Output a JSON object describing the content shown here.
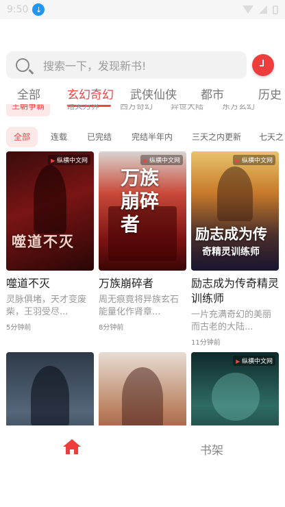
{
  "status_bar": {
    "time": "9:50"
  },
  "search": {
    "placeholder": "搜索一下，发现新书!"
  },
  "tabs": [
    {
      "label": "全部"
    },
    {
      "label": "玄幻奇幻"
    },
    {
      "label": "武侠仙侠"
    },
    {
      "label": "都市"
    },
    {
      "label": "历史"
    }
  ],
  "subcategories": [
    {
      "label": "王朝争霸"
    },
    {
      "label": "诸天万界"
    },
    {
      "label": "西方奇幻"
    },
    {
      "label": "异世大陆"
    },
    {
      "label": "东方玄幻"
    }
  ],
  "filters": [
    {
      "label": "全部"
    },
    {
      "label": "连载"
    },
    {
      "label": "已完结"
    },
    {
      "label": "完结半年内"
    },
    {
      "label": "三天之内更新"
    },
    {
      "label": "七天之"
    }
  ],
  "books": [
    {
      "title": "噬道不灭",
      "desc": "灵脉俱堵，天才变废柴，王羽受尽...",
      "time": "5分钟前",
      "cover_brand": "纵横中文网",
      "cover_title": "噬道不灭"
    },
    {
      "title": "万族崩碎者",
      "desc": "周无痕竟将异族玄石能量化作肾章...",
      "time": "8分钟前",
      "cover_brand": "纵横中文网",
      "cover_title": "万族崩碎者"
    },
    {
      "title": "励志成为传奇精灵训练师",
      "desc": "一片充满奇幻的美丽而古老的大陆...",
      "time": "11分钟前",
      "cover_brand": "纵横中文网",
      "cover_title": "励志成为传",
      "cover_subtitle": "奇精灵训练师"
    },
    {
      "cover_brand": ""
    },
    {
      "cover_brand": ""
    },
    {
      "cover_brand": "纵横中文网"
    }
  ],
  "bottom_nav": {
    "shelf_label": "书架"
  },
  "colors": {
    "accent": "#e94646",
    "tab_inactive": "#777777"
  }
}
